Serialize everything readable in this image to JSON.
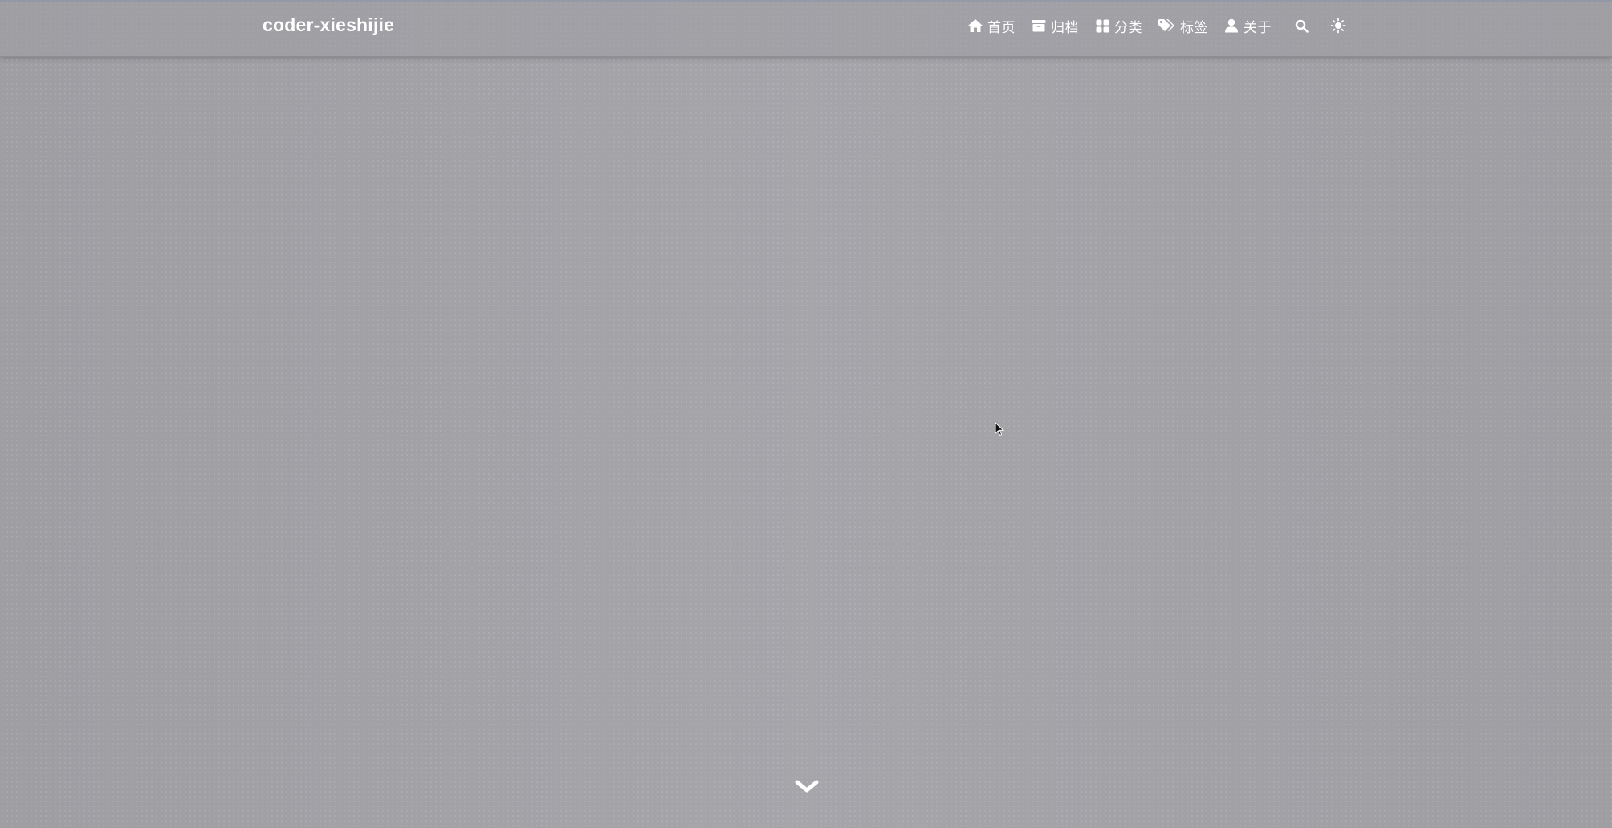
{
  "site": {
    "brand": "coder-xieshijie"
  },
  "nav": {
    "items": [
      {
        "label": "首页",
        "icon": "home-icon"
      },
      {
        "label": "归档",
        "icon": "archive-icon"
      },
      {
        "label": "分类",
        "icon": "grid-icon"
      },
      {
        "label": "标签",
        "icon": "tags-icon"
      },
      {
        "label": "关于",
        "icon": "user-icon"
      }
    ],
    "search_icon": "search-icon",
    "theme_icon": "sun-icon"
  },
  "hero": {
    "scroll_icon": "chevron-down-icon"
  },
  "colors": {
    "background": "#a3a3a8",
    "text": "#ffffff"
  }
}
